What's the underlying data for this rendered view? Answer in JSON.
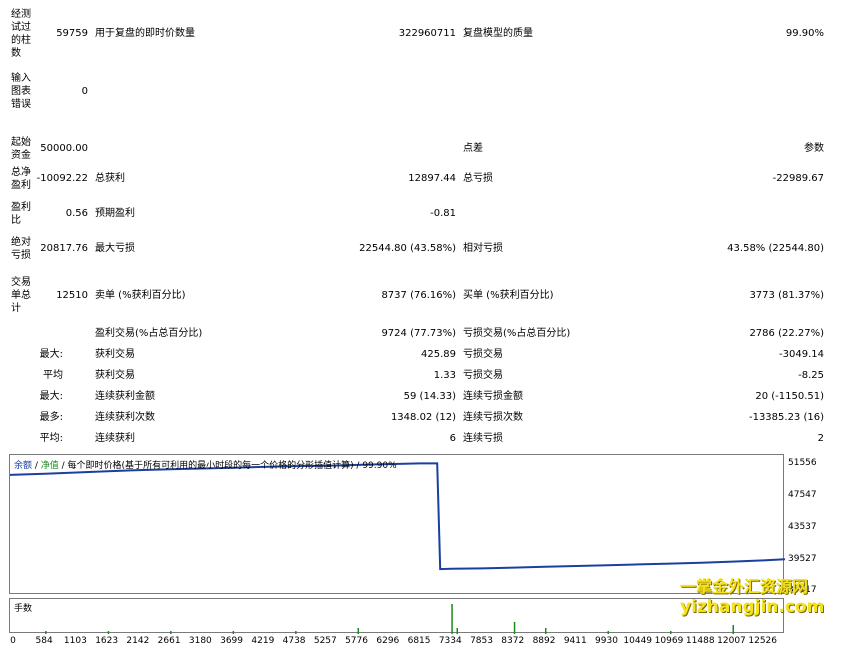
{
  "rows": [
    {
      "label0": "经测试过的柱数",
      "value0": "59759",
      "label1": "用于复盘的即时价数量",
      "value1": "322960711",
      "label2": "复盘模型的质量",
      "value2": "99.90%"
    },
    {
      "label0": "输入图表错误",
      "value0": "0"
    },
    {
      "label0": "起始资金",
      "value0": "50000.00",
      "label2": "点差",
      "value2": "参数"
    },
    {
      "label0": "总净盈利",
      "value0": "-10092.22",
      "label1": "总获利",
      "value1": "12897.44",
      "label2": "总亏损",
      "value2": "-22989.67"
    },
    {
      "label0": "盈利比",
      "value0": "0.56",
      "label1": "预期盈利",
      "value1": "-0.81"
    },
    {
      "label0": "绝对亏损",
      "value0": "20817.76",
      "label1": "最大亏损",
      "value1": "22544.80 (43.58%)",
      "label2": "相对亏损",
      "value2": "43.58% (22544.80)"
    },
    {
      "label0": "交易单总计",
      "value0": "12510",
      "label1": "卖单 (%获利百分比)",
      "value1": "8737 (76.16%)",
      "label2": "买单 (%获利百分比)",
      "value2": "3773 (81.37%)"
    },
    {
      "label1": "盈利交易(%占总百分比)",
      "value1": "9724 (77.73%)",
      "label2": "亏损交易(%占总百分比)",
      "value2": "2786 (22.27%)"
    },
    {
      "sublabel": "最大:",
      "label1": "获利交易",
      "value1": "425.89",
      "label2": "亏损交易",
      "value2": "-3049.14"
    },
    {
      "sublabel": "平均",
      "label1": "获利交易",
      "value1": "1.33",
      "label2": "亏损交易",
      "value2": "-8.25"
    },
    {
      "sublabel": "最大:",
      "label1": "连续获利金额",
      "value1": "59 (14.33)",
      "label2": "连续亏损金额",
      "value2": "20 (-1150.51)"
    },
    {
      "sublabel": "最多:",
      "label1": "连续获利次数",
      "value1": "1348.02 (12)",
      "label2": "连续亏损次数",
      "value2": "-13385.23 (16)"
    },
    {
      "sublabel": "平均:",
      "label1": "连续获利",
      "value1": "6",
      "label2": "连续亏损",
      "value2": "2"
    }
  ],
  "chart_header": {
    "balance": "余额",
    "sep1": " / ",
    "equity": "净值",
    "rest": " / 每个即时价格(基于所有可利用的最小时段的每一个价格的分形插值计算) / 99.90%"
  },
  "volume_label": "手数",
  "watermark": {
    "line1": "一掌金外汇资源网",
    "line2": "yizhangjin.com"
  },
  "chart_data": {
    "type": "line",
    "series": [
      {
        "name": "余额",
        "color": "#1a3f9e",
        "x": [
          0,
          584,
          1103,
          1623,
          2142,
          2661,
          3180,
          3699,
          4219,
          4738,
          5257,
          5776,
          6296,
          6815,
          7100,
          7150,
          7334,
          7853,
          8372,
          8892,
          9411,
          9930,
          10449,
          10969,
          11488,
          12007,
          12526,
          12880
        ],
        "y": [
          50300,
          50450,
          50600,
          50750,
          50900,
          51000,
          51100,
          51200,
          51300,
          51400,
          51450,
          51550,
          51650,
          51750,
          51750,
          38450,
          38500,
          38550,
          38650,
          38750,
          38850,
          38950,
          39050,
          39150,
          39250,
          39400,
          39550,
          39700
        ]
      },
      {
        "name": "净值",
        "color": "#1c8a1c"
      }
    ],
    "x_ticks": [
      0,
      584,
      1103,
      1623,
      2142,
      2661,
      3180,
      3699,
      4219,
      4738,
      5257,
      5776,
      6296,
      6815,
      7334,
      7853,
      8372,
      8892,
      9411,
      9930,
      10449,
      10969,
      11488,
      12007,
      12526
    ],
    "y_ticks": [
      51556,
      47547,
      43537,
      39527,
      35517
    ],
    "xlim": [
      0,
      12880
    ],
    "ylim": [
      35200,
      52800
    ],
    "volume": {
      "x": [
        584,
        1623,
        2661,
        3699,
        4738,
        5776,
        7334,
        7420,
        8372,
        8892,
        9930,
        10969,
        12007
      ],
      "y": [
        1,
        1,
        1,
        1,
        1,
        2,
        10,
        2,
        4,
        2,
        1,
        1,
        3
      ]
    },
    "grid": false,
    "legend": "none"
  },
  "colors": {
    "balance": "#1a3f9e",
    "equity": "#1c8a1c",
    "volume": "#1c8a1c"
  }
}
